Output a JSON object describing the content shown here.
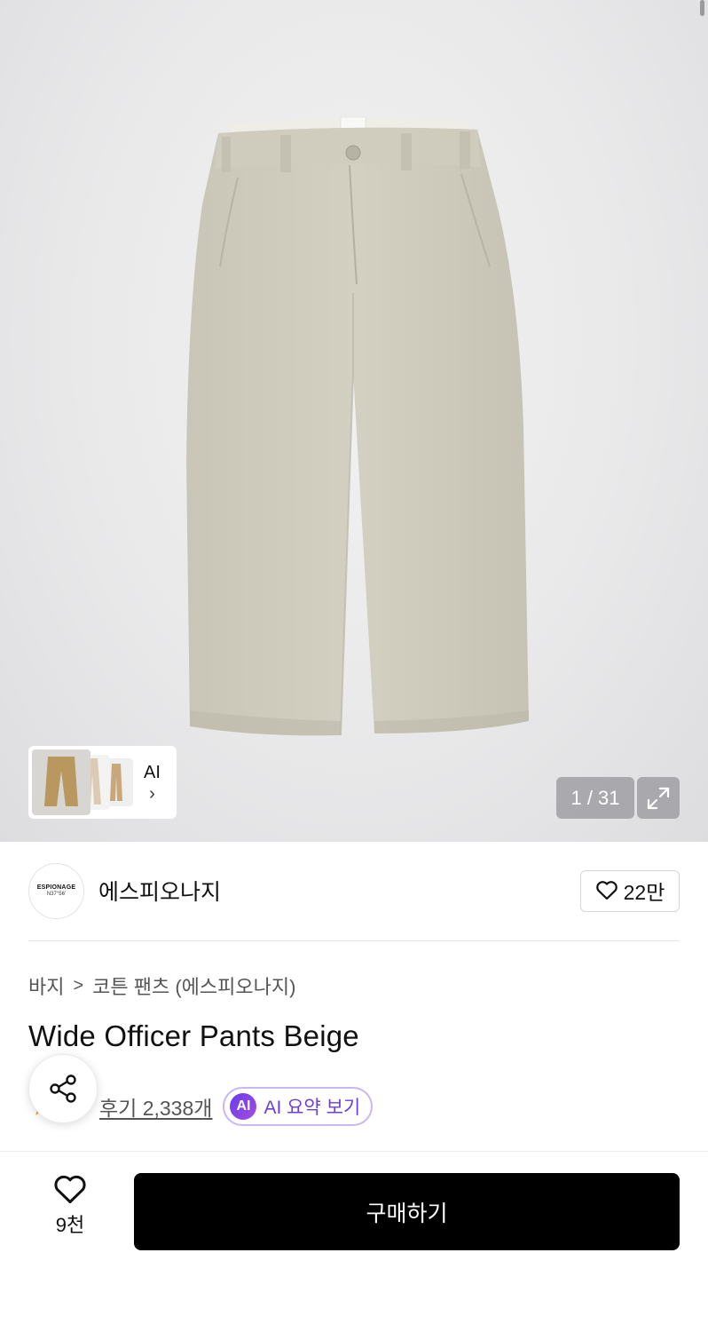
{
  "gallery": {
    "counter": "1 / 31",
    "ai_thumb_label": "AI",
    "ai_thumb_chevron": "›"
  },
  "brand": {
    "logo_text": "ESPIONAGE",
    "logo_subtext": "N37°56'",
    "name": "에스피오나지",
    "like_count": "22만"
  },
  "breadcrumb": {
    "category": "바지",
    "separator": ">",
    "subcategory": "코튼 팬츠 (에스피오나지)"
  },
  "product": {
    "title": "Wide Officer Pants Beige"
  },
  "reviews": {
    "review_link": "후기 2,338개",
    "ai_badge": "AI",
    "ai_summary": "AI 요약 보기"
  },
  "bottom_bar": {
    "wish_count": "9천",
    "buy_label": "구매하기"
  },
  "icons": {
    "expand": "expand-icon",
    "heart": "heart-icon",
    "share": "share-icon",
    "star": "star-icon"
  },
  "colors": {
    "ai_accent": "#6b3fd8",
    "buy_button": "#000000",
    "star": "#f5a623"
  }
}
